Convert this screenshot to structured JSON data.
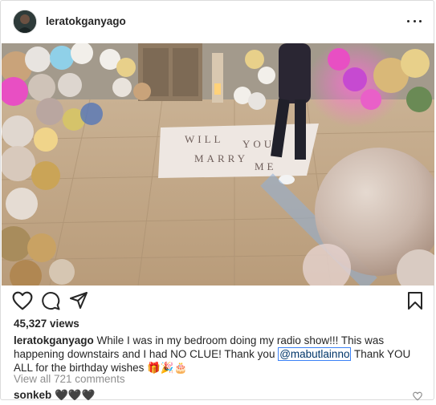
{
  "post": {
    "username": "leratokganyago",
    "views": "45,327 views",
    "caption": {
      "username": "leratokganyago",
      "text_before": "While I was in my bedroom doing my radio show!!! This was happening downstairs and I had NO CLUE! Thank you ",
      "mention": "@mabutlainno",
      "text_after": " Thank YOU ALL for the birthday wishes 🎁🎉🎂"
    },
    "view_comments": "View all 721 comments",
    "comment": {
      "username": "sonkeb",
      "text": "🖤🖤🖤"
    },
    "media_text": [
      "WILL",
      "YOU",
      "MARRY",
      "ME"
    ]
  },
  "icons": {
    "more": "more-horizontal-icon",
    "like": "heart-icon",
    "comment": "comment-icon",
    "share": "paper-plane-icon",
    "save": "bookmark-icon",
    "comment_like": "heart-icon"
  },
  "colors": {
    "text": "#262626",
    "muted": "#8e8e8e",
    "mention": "#003569",
    "border": "#dbdbdb"
  }
}
